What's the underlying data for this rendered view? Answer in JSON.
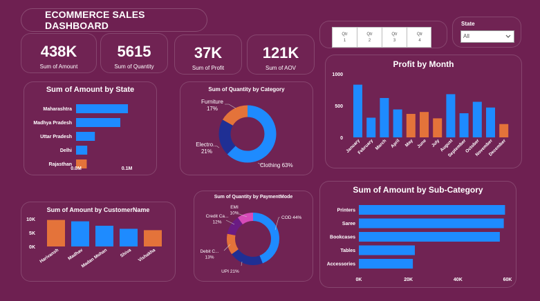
{
  "dashboard": {
    "title": "ECOMMERCE SALES DASHBOARD"
  },
  "kpis": [
    {
      "value": "438K",
      "label": "Sum of Amount"
    },
    {
      "value": "5615",
      "label": "Sum of Quantity"
    },
    {
      "value": "37K",
      "label": "Sum of Profit"
    },
    {
      "value": "121K",
      "label": "Sum of AOV"
    }
  ],
  "quarter_slicer": {
    "items": [
      {
        "top": "Qtr",
        "bottom": "1"
      },
      {
        "top": "Qtr",
        "bottom": "2"
      },
      {
        "top": "Qtr",
        "bottom": "3"
      },
      {
        "top": "Qtr",
        "bottom": "4"
      }
    ]
  },
  "state_slicer": {
    "label": "State",
    "selected": "All"
  },
  "colors": {
    "background": "#6e2051",
    "blue": "#1e8bff",
    "orange": "#e4733a",
    "navy": "#1f2f94",
    "purple": "#6a1b83",
    "pink": "#d64bb8"
  },
  "chart_data": [
    {
      "id": "profit_by_month",
      "type": "bar",
      "title": "Profit by Month",
      "categories": [
        "January",
        "February",
        "March",
        "April",
        "May",
        "June",
        "July",
        "August",
        "September",
        "October",
        "November",
        "December"
      ],
      "values": [
        830,
        310,
        620,
        440,
        370,
        400,
        300,
        680,
        380,
        560,
        470,
        210
      ],
      "bar_colors": [
        "blue",
        "blue",
        "blue",
        "blue",
        "orange",
        "orange",
        "orange",
        "blue",
        "blue",
        "blue",
        "blue",
        "orange"
      ],
      "yticks": [
        "1000",
        "500",
        "0"
      ],
      "ylim": [
        0,
        1000
      ]
    },
    {
      "id": "amount_by_state",
      "type": "bar",
      "orientation": "horizontal",
      "title": "Sum of Amount by State",
      "categories": [
        "Maharashtra",
        "Madhya Pradesh",
        "Uttar Pradesh",
        "Delhi",
        "Rajasthan"
      ],
      "values": [
        0.102,
        0.087,
        0.037,
        0.022,
        0.021
      ],
      "bar_colors": [
        "blue",
        "blue",
        "blue",
        "blue",
        "orange"
      ],
      "xticks": [
        "0.0M",
        "0.1M"
      ],
      "xlim": [
        0,
        0.14
      ]
    },
    {
      "id": "quantity_by_category",
      "type": "pie",
      "title": "Sum of Quantity by Category",
      "labels": [
        "Clothing",
        "Electro...",
        "Furniture"
      ],
      "values": [
        63,
        21,
        17
      ],
      "label_texts": [
        "Clothing 63%",
        "Electro...\n21%",
        "Furniture\n17%"
      ],
      "colors": [
        "blue",
        "navy",
        "orange"
      ]
    },
    {
      "id": "quantity_by_paymentmode",
      "type": "pie",
      "title": "Sum of Quantity by PaymentMode",
      "labels": [
        "COD",
        "UPI",
        "Debit C...",
        "Credit Ca...",
        "EMI"
      ],
      "values": [
        44,
        21,
        13,
        12,
        10
      ],
      "label_texts": [
        "COD 44%",
        "UPI 21%",
        "Debit C...\n13%",
        "Credit Ca...\n12%",
        "EMI\n10%"
      ],
      "colors": [
        "blue",
        "navy",
        "orange",
        "purple",
        "pink"
      ]
    },
    {
      "id": "amount_by_customer",
      "type": "bar",
      "title": "Sum of Amount by CustomerName",
      "categories": [
        "Harivansh",
        "Madhav",
        "Madan Mohan",
        "Shiva",
        "Vishakha"
      ],
      "values": [
        9600,
        9100,
        7500,
        6400,
        5900
      ],
      "bar_colors": [
        "orange",
        "blue",
        "blue",
        "blue",
        "orange"
      ],
      "yticks": [
        "10K",
        "5K",
        "0K"
      ],
      "ylim": [
        0,
        10000
      ]
    },
    {
      "id": "amount_by_subcategory",
      "type": "bar",
      "orientation": "horizontal",
      "title": "Sum of Amount by Sub-Category",
      "categories": [
        "Printers",
        "Saree",
        "Bookcases",
        "Tables",
        "Accessories"
      ],
      "values": [
        59000,
        58500,
        56900,
        22600,
        21800
      ],
      "bar_colors": [
        "blue",
        "blue",
        "blue",
        "blue",
        "blue"
      ],
      "xticks": [
        "0K",
        "20K",
        "40K",
        "60K"
      ],
      "xlim": [
        0,
        60000
      ]
    }
  ]
}
